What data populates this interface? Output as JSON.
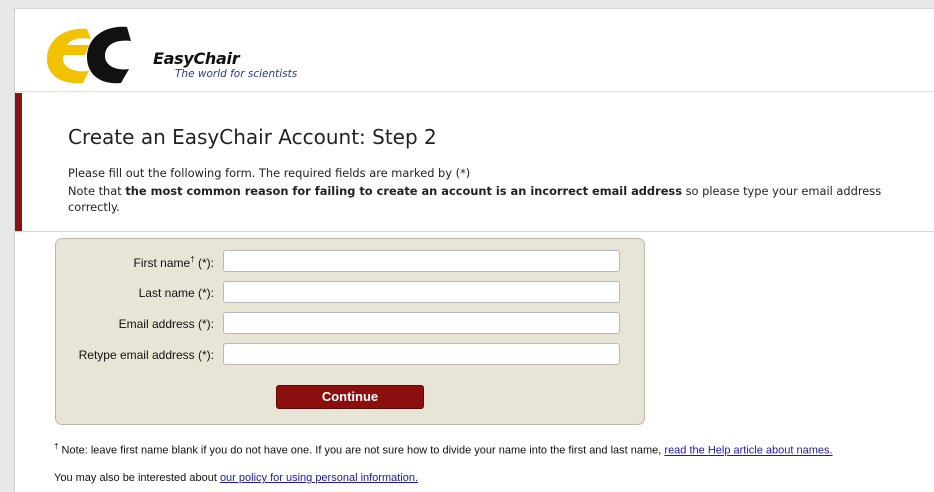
{
  "logo": {
    "name": "EasyChair",
    "tagline": "The world for scientists"
  },
  "heading": {
    "title": "Create an EasyChair Account: Step 2",
    "instruction_1": "Please fill out the following form. The required fields are marked by (*)",
    "instruction_2_prefix": "Note that ",
    "instruction_2_bold": "the most common reason for failing to create an account is an incorrect email address",
    "instruction_2_suffix": " so please type your email address",
    "instruction_2_cont": "correctly."
  },
  "form": {
    "fields": [
      {
        "label": "First name",
        "marker": "†",
        "required": " (*):",
        "value": ""
      },
      {
        "label": "Last name (*):",
        "value": ""
      },
      {
        "label": "Email address (*):",
        "value": ""
      },
      {
        "label": "Retype email address (*):",
        "value": ""
      }
    ],
    "continue_label": "Continue"
  },
  "footnotes": {
    "note_marker": "†",
    "note_text": " Note: leave first name blank if you do not have one. If you are not sure how to divide your name into the first and last name, ",
    "note_link": "read the Help article about names.",
    "policy_text": "You may also be interested about ",
    "policy_link": "our policy for using personal information."
  },
  "colors": {
    "accent": "#8b1212",
    "form_bg": "#e8e5d7",
    "link": "#1a1aa6"
  }
}
